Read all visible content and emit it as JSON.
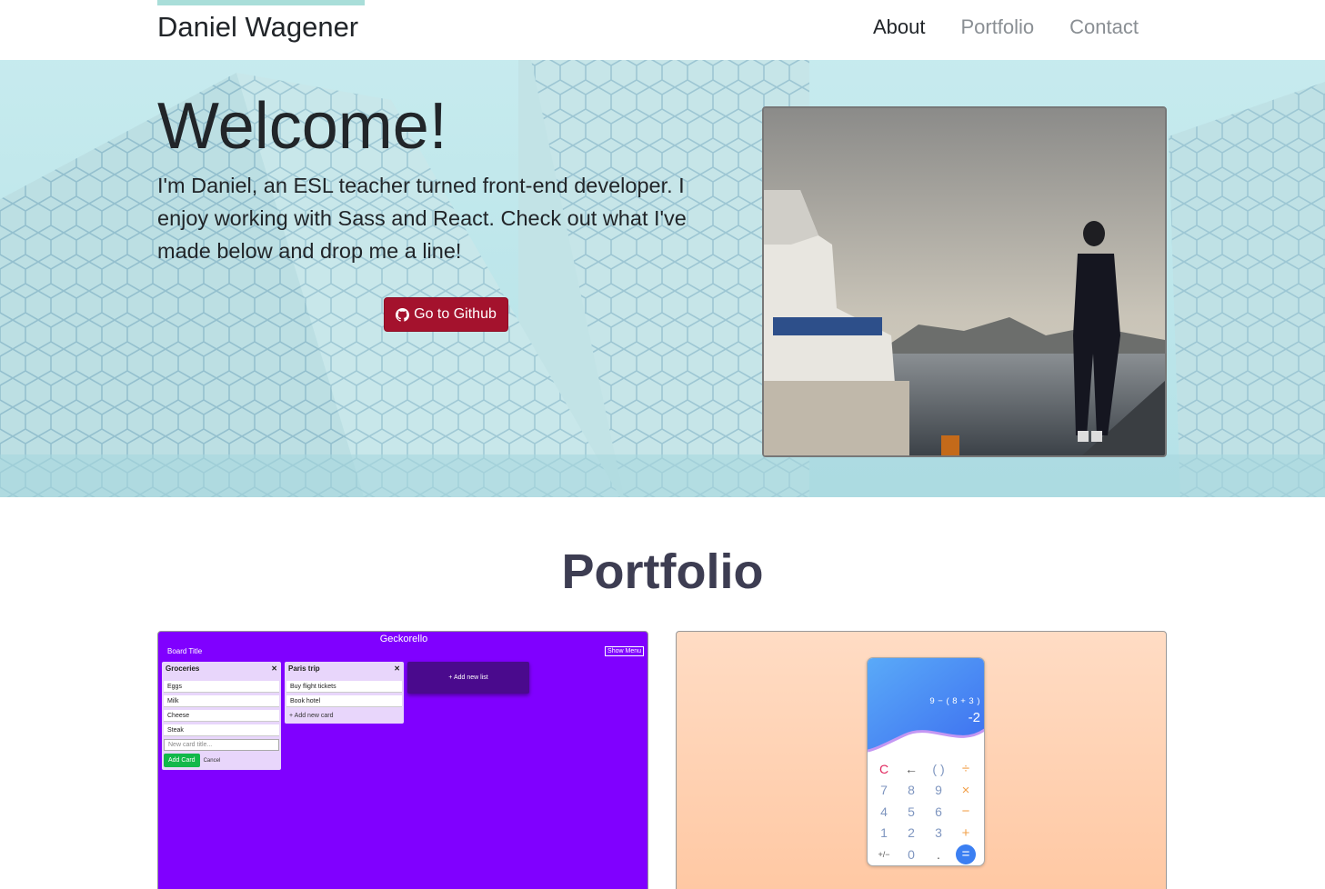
{
  "navbar": {
    "brand": "Daniel Wagener",
    "links": [
      {
        "label": "About",
        "active": true
      },
      {
        "label": "Portfolio",
        "active": false
      },
      {
        "label": "Contact",
        "active": false
      }
    ]
  },
  "hero": {
    "title": "Welcome!",
    "intro": "I'm Daniel, an ESL teacher turned front-end developer. I enjoy working with Sass and React. Check out what I've made below and drop me a line!",
    "github_button": "Go to Github"
  },
  "portfolio": {
    "title": "Portfolio",
    "geckorello": {
      "app_title": "Geckorello",
      "board_title": "Board Title",
      "show_menu": "Show Menu",
      "lists": [
        {
          "title": "Groceries",
          "cards": [
            "Eggs",
            "Milk",
            "Cheese",
            "Steak"
          ],
          "input_placeholder": "New card title...",
          "add_label": "Add Card",
          "cancel_label": "Cancel"
        },
        {
          "title": "Paris trip",
          "cards": [
            "Buy flight tickets",
            "Book hotel"
          ],
          "add_new_card": "Add new card"
        }
      ],
      "add_new_list": "+ Add new list"
    },
    "calculator": {
      "expression": "9 − ( 8 + 3 )",
      "result": "-2",
      "keys": [
        "C",
        "←",
        "( )",
        "÷",
        "7",
        "8",
        "9",
        "×",
        "4",
        "5",
        "6",
        "−",
        "1",
        "2",
        "3",
        "+",
        "+/−",
        "0",
        ".",
        "="
      ]
    }
  },
  "colors": {
    "accent": "#a9ded9",
    "github_button": "#a4122d",
    "geckorello_bg": "#8000ff"
  }
}
